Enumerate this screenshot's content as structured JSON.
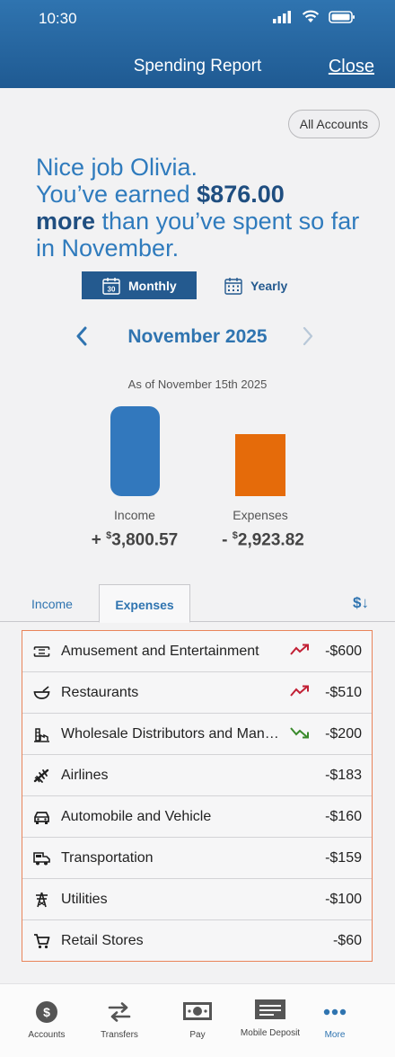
{
  "status_bar": {
    "time": "10:30"
  },
  "header": {
    "title": "Spending Report",
    "close_label": "Close"
  },
  "accounts_filter": {
    "label": "All Accounts"
  },
  "summary": {
    "line1": "Nice job Olivia.",
    "line2_prefix": "You’ve earned ",
    "amount": "$876.00",
    "more": "more",
    "line3_suffix": " than you’ve spent so far in November."
  },
  "period_toggle": {
    "monthly": "Monthly",
    "yearly": "Yearly",
    "monthly_icon_day": "30",
    "selected": "Monthly"
  },
  "month_nav": {
    "label": "November 2025"
  },
  "as_of": "As of November 15th 2025",
  "comparison": {
    "income_label": "Income",
    "income_sign": "+ ",
    "income_currency": "$",
    "income_amount": "3,800.57",
    "expenses_label": "Expenses",
    "expenses_sign": "- ",
    "expenses_currency": "$",
    "expenses_amount": "2,923.82",
    "colors": {
      "income": "#3278bd",
      "expenses": "#e56b0a"
    }
  },
  "tabs": [
    {
      "label": "Income"
    },
    {
      "label": "Expenses",
      "selected": true
    }
  ],
  "sort_icon": "sort-descending-dollar-icon",
  "categories": [
    {
      "name": "Amusement and Entertainment",
      "amount": "-$600",
      "trend": "up",
      "icon": "ticket-icon"
    },
    {
      "name": "Restaurants",
      "amount": "-$510",
      "trend": "up",
      "icon": "bowl-icon"
    },
    {
      "name": "Wholesale Distributors and Manufacturers",
      "amount": "-$200",
      "trend": "down",
      "icon": "factory-icon"
    },
    {
      "name": "Airlines",
      "amount": "-$183",
      "trend": "",
      "icon": "airplane-icon"
    },
    {
      "name": "Automobile and Vehicle",
      "amount": "-$160",
      "trend": "",
      "icon": "car-icon"
    },
    {
      "name": "Transportation",
      "amount": "-$159",
      "trend": "",
      "icon": "bus-icon"
    },
    {
      "name": "Utilities",
      "amount": "-$100",
      "trend": "",
      "icon": "power-tower-icon"
    },
    {
      "name": "Retail Stores",
      "amount": "-$60",
      "trend": "",
      "icon": "cart-icon"
    }
  ],
  "trend_colors": {
    "up": "#c22035",
    "down": "#3a8a2c"
  },
  "bottom_nav": [
    {
      "label": "Accounts",
      "icon": "dollar-coin-icon"
    },
    {
      "label": "Transfers",
      "icon": "transfer-arrows-icon"
    },
    {
      "label": "Pay",
      "icon": "bill-icon"
    },
    {
      "label": "Mobile Deposit",
      "icon": "check-deposit-icon"
    },
    {
      "label": "More",
      "icon": "more-dots-icon",
      "active": true
    }
  ]
}
